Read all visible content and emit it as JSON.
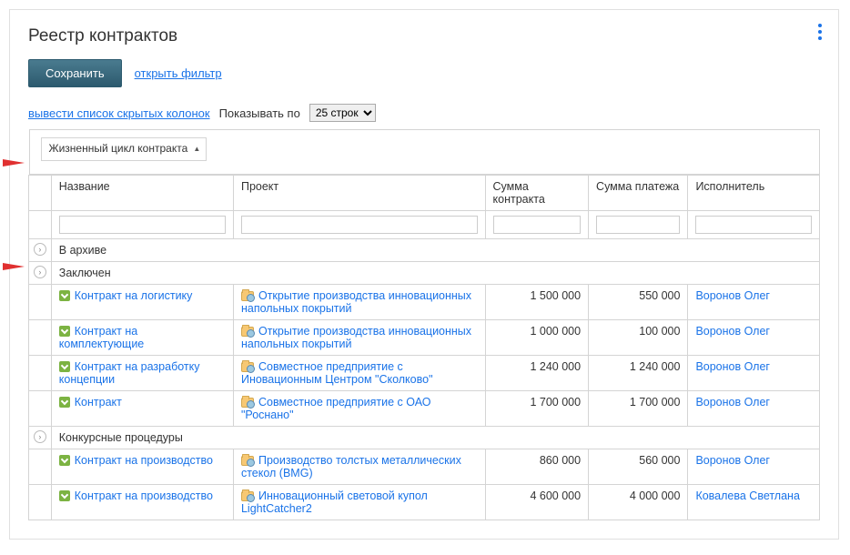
{
  "title": "Реестр контрактов",
  "buttons": {
    "save": "Сохранить",
    "openFilter": "открыть фильтр"
  },
  "toolbar": {
    "showHiddenCols": "вывести список скрытых колонок",
    "showByLabel": "Показывать по",
    "pageSize": "25 строк"
  },
  "grouping": {
    "label": "Жизненный цикл контракта"
  },
  "columns": {
    "name": "Название",
    "project": "Проект",
    "contractSum": "Сумма контракта",
    "paymentSum": "Сумма платежа",
    "executor": "Исполнитель"
  },
  "groups": [
    {
      "title": "В архиве",
      "rows": []
    },
    {
      "title": "Заключен",
      "rows": [
        {
          "name": "Контракт на логистику",
          "project": "Открытие производства инновационных напольных покрытий",
          "contractSum": "1 500 000",
          "paymentSum": "550 000",
          "executor": "Воронов Олег"
        },
        {
          "name": "Контракт на комплектующие",
          "project": "Открытие производства инновационных напольных покрытий",
          "contractSum": "1 000 000",
          "paymentSum": "100 000",
          "executor": "Воронов Олег"
        },
        {
          "name": "Контракт на разработку концепции",
          "project": "Совместное предприятие с Иновационным Центром \"Сколково\"",
          "contractSum": "1 240 000",
          "paymentSum": "1 240 000",
          "executor": "Воронов Олег"
        },
        {
          "name": "Контракт",
          "project": "Совместное предприятие с ОАО \"Роснано\"",
          "contractSum": "1 700 000",
          "paymentSum": "1 700 000",
          "executor": "Воронов Олег"
        }
      ]
    },
    {
      "title": "Конкурсные процедуры",
      "rows": [
        {
          "name": "Контракт на производство",
          "project": "Производство толстых металлических стекол (BMG)",
          "contractSum": "860 000",
          "paymentSum": "560 000",
          "executor": "Воронов Олег"
        },
        {
          "name": "Контракт на производство",
          "project": "Инновационный световой купол LightCatcher2",
          "contractSum": "4 600 000",
          "paymentSum": "4 000 000",
          "executor": "Ковалева Светлана"
        }
      ]
    }
  ]
}
